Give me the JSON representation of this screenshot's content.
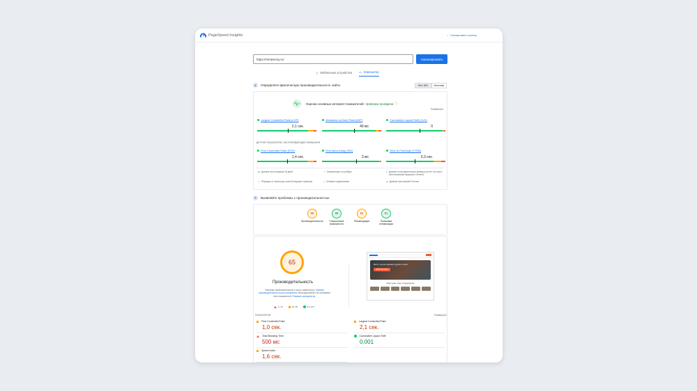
{
  "app": {
    "name": "PageSpeed Insights",
    "copy_link": "Скопировать ссылку"
  },
  "search": {
    "url": "https://miratermy.ru/",
    "analyze_label": "Анализировать"
  },
  "tabs": {
    "mobile": "Мобильные устройства",
    "desktop": "Компьютер",
    "active": "desktop"
  },
  "field": {
    "title": "Определите фактическую производительность сайта",
    "switch": [
      "Этот URL",
      "Источник"
    ],
    "cwv_text": "Оценка основных интернет-показателей:",
    "cwv_status": "проверка пройдена",
    "expand": "Развернуть",
    "metrics": [
      {
        "name": "Largest Contentful Paint (LCP)",
        "value": "2,1 сек.",
        "good": 0.86,
        "ni": 0.09,
        "poor": 0.05
      },
      {
        "name": "Interaction to Next Paint (INP)",
        "value": "49 мс",
        "good": 0.9,
        "ni": 0.06,
        "poor": 0.04
      },
      {
        "name": "Cumulative Layout Shift (CLS)",
        "value": "0",
        "good": 0.95,
        "ni": 0.03,
        "poor": 0.02
      }
    ],
    "other_label": "ДРУГИЕ ПОКАЗАТЕЛИ, ЗАСЛУЖИВАЮЩИЕ ВНИМАНИЯ",
    "other_metrics": [
      {
        "name": "First Contentful Paint (FCP)",
        "value": "1,4 сек.",
        "good": 0.85,
        "ni": 0.1,
        "poor": 0.05
      },
      {
        "name": "First Input Delay (FID)",
        "value": "3 мс",
        "good": 0.97,
        "ni": 0.02,
        "poor": 0.01
      },
      {
        "name": "Time to First Byte (TTFB)",
        "value": "0,3 сек.",
        "good": 0.8,
        "ni": 0.13,
        "poor": 0.07
      }
    ],
    "info": [
      "Данные за последние 28 дней",
      "Компьютеры и ноутбуки",
      "Данные пользовательских выборок (отчет об опыте использования браузера Chrome)",
      "Периоды от начала до полной загрузки страницы",
      "Сетевые подключения",
      "Данные всех версий Chrome"
    ]
  },
  "diagnose": {
    "title": "Выявляйте проблемы с производительностью",
    "scores": [
      {
        "value": "65",
        "label": "Производительность",
        "level": "orange"
      },
      {
        "value": "98",
        "label": "Специальные возможности",
        "level": "green"
      },
      {
        "value": "52",
        "label": "Рекомендации",
        "level": "orange"
      },
      {
        "value": "91",
        "label": "Поисковая оптимизация",
        "level": "green"
      }
    ],
    "main_score": "65",
    "main_label": "Производительность",
    "desc_1": "Значения приблизительные и могут изменяться.",
    "desc_link_1": "Уровень производительности рассчитывается",
    "desc_2": "непосредственно на основании этих показателей.",
    "desc_link_2": "Показать калькулятор.",
    "legend": [
      "0–49",
      "50–89",
      "90–100"
    ],
    "screenshot": {
      "hero_text": "Место, где вы отдыхаете душой и телом",
      "hero_button": "Забронировать",
      "sub_text": "Мира термы: отдых и оздоровление"
    },
    "metrics_label": "ПОКАЗАТЕЛИ",
    "expand": "Развернуть",
    "lab_metrics": [
      {
        "name": "First Contentful Paint",
        "value": "1,0 сек.",
        "level": "orange"
      },
      {
        "name": "Largest Contentful Paint",
        "value": "2,1 сек.",
        "level": "orange"
      },
      {
        "name": "Total Blocking Time",
        "value": "500 мс",
        "level": "red"
      },
      {
        "name": "Cumulative Layout Shift",
        "value": "0.001",
        "level": "green"
      },
      {
        "name": "Speed Index",
        "value": "1,6 сек.",
        "level": "orange"
      }
    ]
  },
  "colors": {
    "accent": "#1a73e8",
    "good": "#0cce6b",
    "average": "#ffa400",
    "poor": "#ff4e42"
  }
}
